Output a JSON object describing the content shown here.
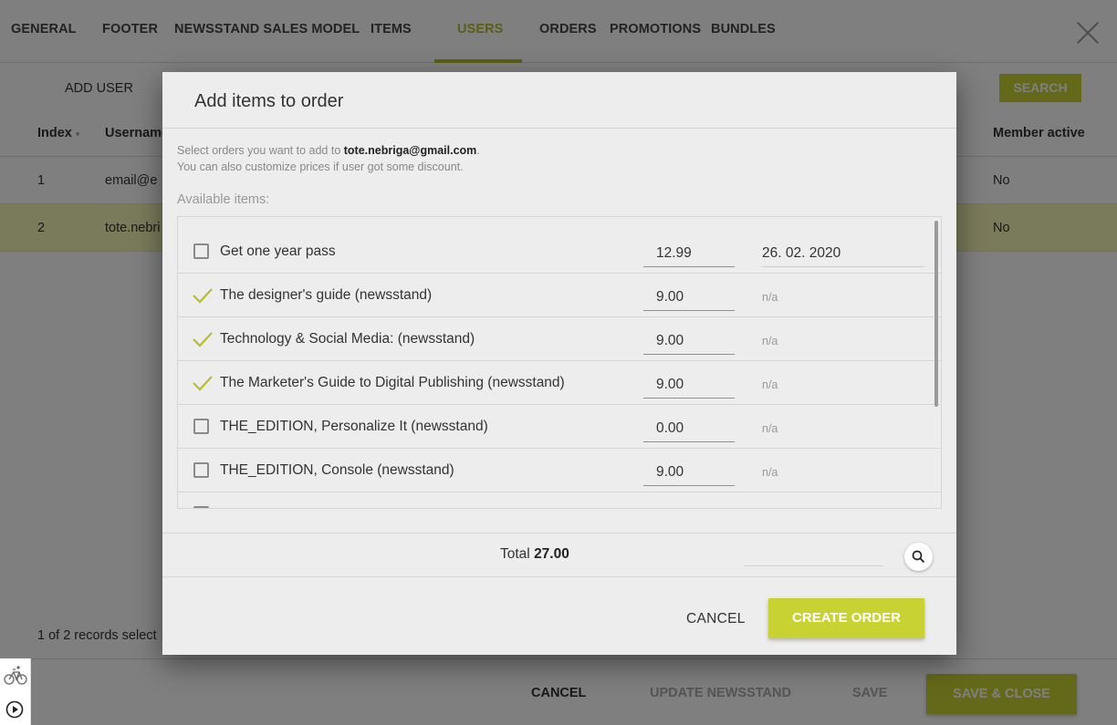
{
  "tabs": [
    {
      "label": "GENERAL"
    },
    {
      "label": "FOOTER"
    },
    {
      "label": "NEWSSTAND SALES MODEL"
    },
    {
      "label": "ITEMS"
    },
    {
      "label": "USERS"
    },
    {
      "label": "ORDERS"
    },
    {
      "label": "PROMOTIONS"
    },
    {
      "label": "BUNDLES"
    }
  ],
  "active_tab": "USERS",
  "toolbar": {
    "add_user_label": "ADD USER",
    "search_label": "SEARCH"
  },
  "table": {
    "headers": {
      "index": "Index",
      "username": "Username",
      "member_active": "Member active"
    },
    "rows": [
      {
        "index": "1",
        "username": "email@e",
        "member_active": "No"
      },
      {
        "index": "2",
        "username": "tote.nebri",
        "member_active": "No"
      }
    ]
  },
  "records_label": "1 of 2 records select",
  "footer": {
    "cancel_label": "CANCEL",
    "update_label": "UPDATE NEWSSTAND",
    "save_label": "SAVE",
    "save_close_label": "SAVE & CLOSE"
  },
  "dialog": {
    "title": "Add items to order",
    "info_prefix": "Select orders you want to add to ",
    "email": "tote.nebriga@gmail.com",
    "info_suffix": ".",
    "info_line2": "You can also customize prices if user got some discount.",
    "available_label": "Available items:",
    "items": [
      {
        "name": "Get one year pass",
        "checked": false,
        "price": "12.99",
        "date": "26. 02. 2020"
      },
      {
        "name": "The designer's guide (newsstand)",
        "checked": true,
        "price": "9.00",
        "date": "n/a"
      },
      {
        "name": "Technology & Social Media: (newsstand)",
        "checked": true,
        "price": "9.00",
        "date": "n/a"
      },
      {
        "name": "The Marketer's Guide to Digital Publishing (newsstand)",
        "checked": true,
        "price": "9.00",
        "date": "n/a"
      },
      {
        "name": "THE_EDITION, Personalize It (newsstand)",
        "checked": false,
        "price": "0.00",
        "date": "n/a"
      },
      {
        "name": "THE_EDITION, Console (newsstand)",
        "checked": false,
        "price": "9.00",
        "date": "n/a"
      }
    ],
    "total_label": "Total",
    "total_value": "27.00",
    "cancel_label": "CANCEL",
    "create_label": "CREATE ORDER"
  },
  "colors": {
    "accent": "#c9d233",
    "accent_text": "#b5be2c",
    "overlay": "rgba(0,0,0,0.5)"
  }
}
